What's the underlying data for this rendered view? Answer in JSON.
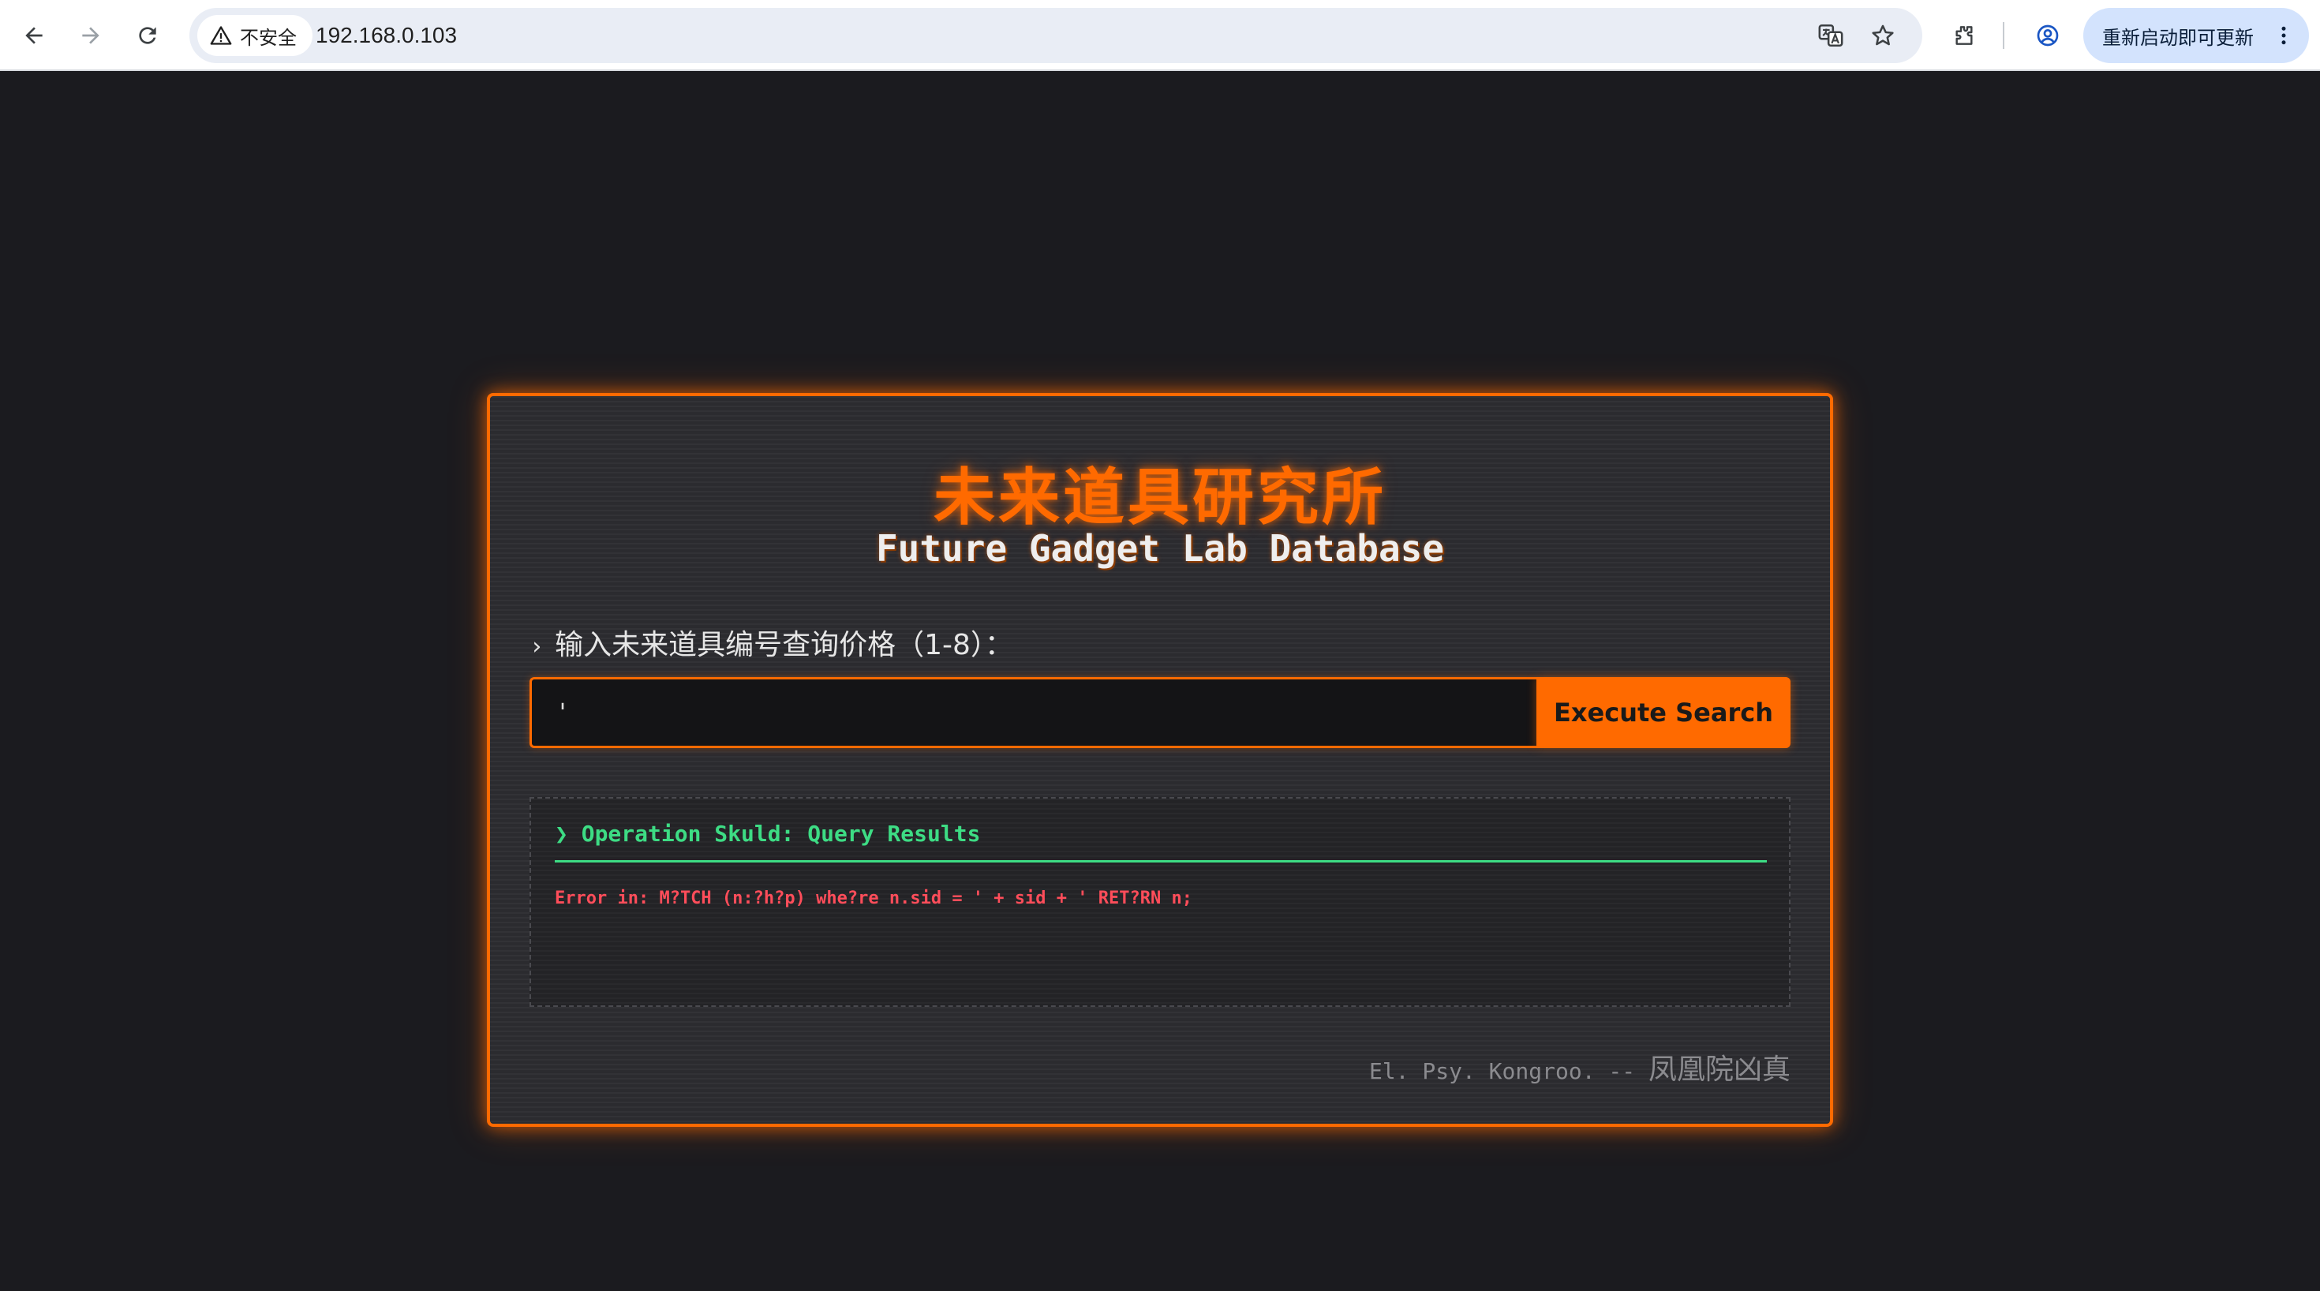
{
  "browser": {
    "security_label": "不安全",
    "url": "192.168.0.103",
    "relaunch_label": "重新启动即可更新"
  },
  "page": {
    "title_cn": "未来道具研究所",
    "title_en": "Future Gadget Lab Database",
    "prompt_chevron": "›",
    "prompt_label": "输入未来道具编号查询价格（1-8）：",
    "input_value": "'",
    "execute_label": "Execute Search",
    "results_header": "❯ Operation Skuld: Query Results",
    "error_message": "Error in: M?TCH (n:?h?p) whe?re n.sid = ' + sid + ' RET?RN n;",
    "footer_quote": "El. Psy. Kongroo. -- ",
    "footer_author": "凤凰院凶真"
  },
  "colors": {
    "accent": "#ff6a00",
    "success": "#3ddc84",
    "error": "#ff4d5a",
    "background": "#1b1b1f"
  }
}
